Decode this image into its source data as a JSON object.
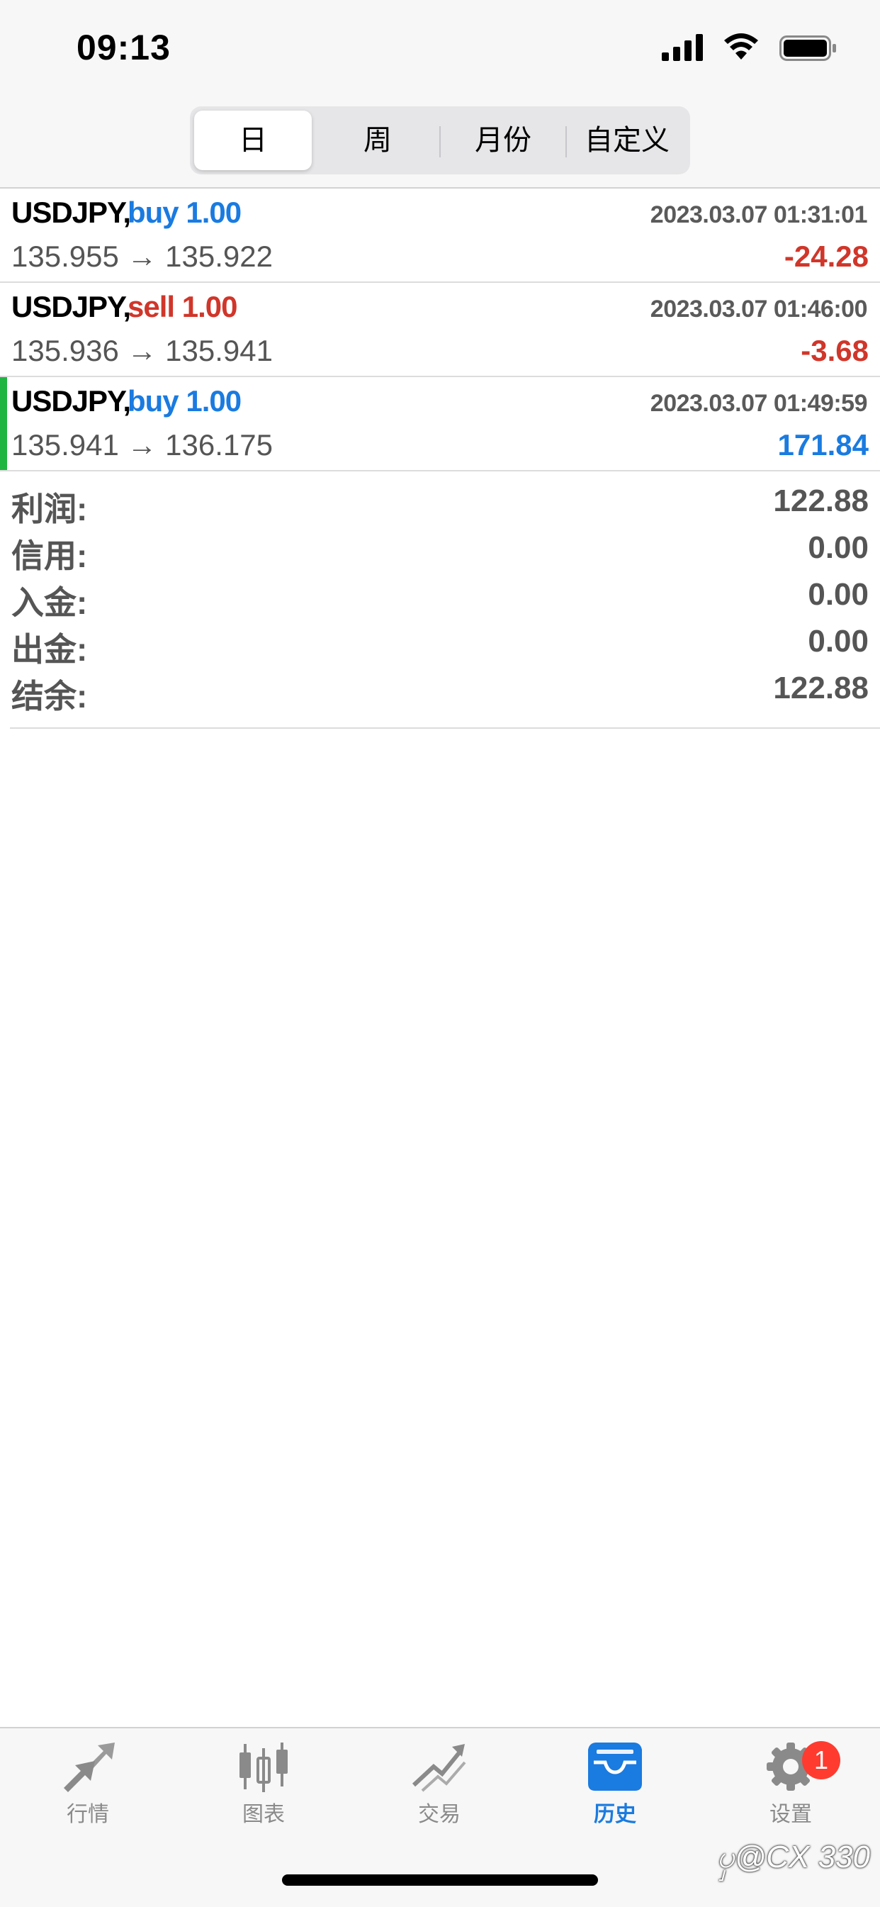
{
  "status_bar": {
    "time": "09:13"
  },
  "period_tabs": {
    "items": [
      "日",
      "周",
      "月份",
      "自定义"
    ],
    "active": "日"
  },
  "deals": [
    {
      "symbol": "USDJPY,",
      "side": "buy 1.00",
      "side_color": "#1a7be0",
      "time": "2023.03.07 01:31:01",
      "open_price": "135.955",
      "arrow": "→",
      "close_price": "135.922",
      "profit": "-24.28",
      "profit_color": "#d0362a"
    },
    {
      "symbol": "USDJPY,",
      "side": "sell 1.00",
      "side_color": "#d0362a",
      "time": "2023.03.07 01:46:00",
      "open_price": "135.936",
      "arrow": "→",
      "close_price": "135.941",
      "profit": "-3.68",
      "profit_color": "#d0362a"
    },
    {
      "symbol": "USDJPY,",
      "side": "buy 1.00",
      "side_color": "#1a7be0",
      "time": "2023.03.07 01:49:59",
      "open_price": "135.941",
      "arrow": "→",
      "close_price": "136.175",
      "profit": "171.84",
      "profit_color": "#1a7be0",
      "selected": true
    }
  ],
  "summary": [
    {
      "label": "利润:",
      "value": "122.88"
    },
    {
      "label": "信用:",
      "value": "0.00"
    },
    {
      "label": "入金:",
      "value": "0.00"
    },
    {
      "label": "出金:",
      "value": "0.00"
    },
    {
      "label": "结余:",
      "value": "122.88"
    }
  ],
  "tab_bar": {
    "items": [
      {
        "label": "行情",
        "icon": "quotes-arrows-icon"
      },
      {
        "label": "图表",
        "icon": "candlestick-chart-icon"
      },
      {
        "label": "交易",
        "icon": "trade-trend-icon"
      },
      {
        "label": "历史",
        "icon": "history-inbox-icon",
        "active": true
      },
      {
        "label": "设置",
        "icon": "gear-icon",
        "badge": "1"
      }
    ]
  },
  "watermark": "ၦ@CX 330",
  "colors": {
    "accent_blue": "#1a7be0",
    "loss_red": "#d0362a",
    "selected_green": "#1fb541"
  }
}
